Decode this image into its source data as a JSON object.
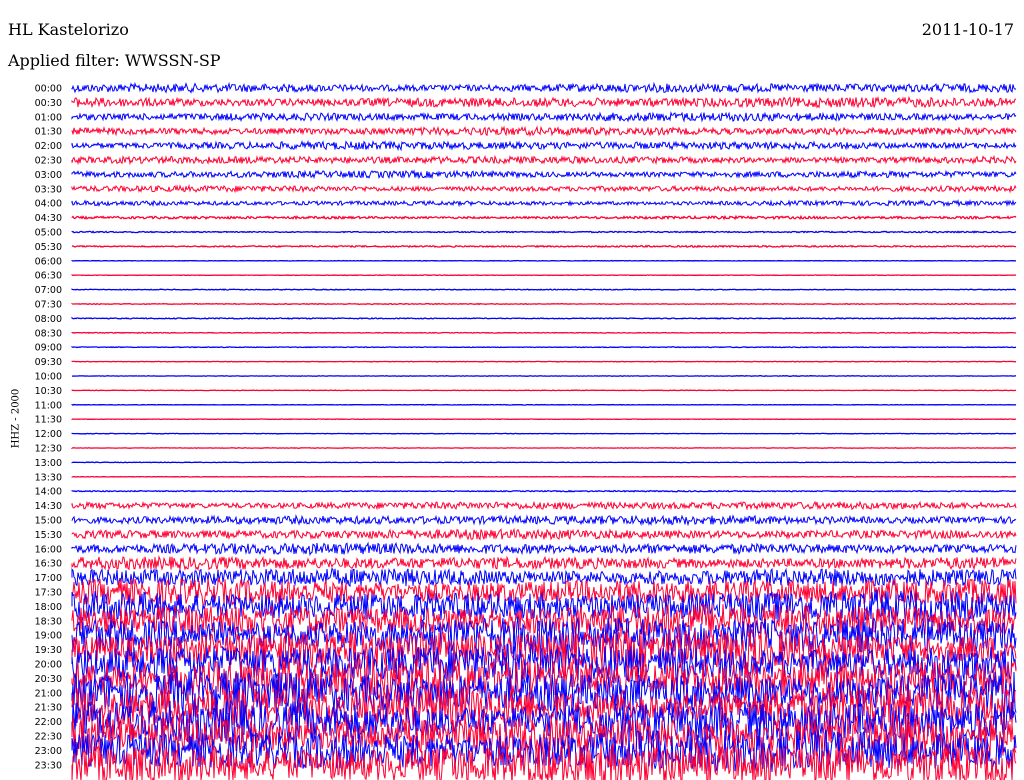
{
  "header": {
    "station": "HL Kastelorizo",
    "date": "2011-10-17",
    "filter": "Applied filter: WWSSN-SP"
  },
  "ylabel": "HHZ - 2000",
  "colors": {
    "a": "#0000ff",
    "b": "#ff0033",
    "text": "#000000",
    "background": "#ffffff"
  },
  "time_labels": [
    "00:00",
    "00:30",
    "01:00",
    "01:30",
    "02:00",
    "02:30",
    "03:00",
    "03:30",
    "04:00",
    "04:30",
    "05:00",
    "05:30",
    "06:00",
    "06:30",
    "07:00",
    "07:30",
    "08:00",
    "08:30",
    "09:00",
    "09:30",
    "10:00",
    "10:30",
    "11:00",
    "11:30",
    "12:00",
    "12:30",
    "13:00",
    "13:30",
    "14:00",
    "14:30",
    "15:00",
    "15:30",
    "16:00",
    "16:30",
    "17:00",
    "17:30",
    "18:00",
    "18:30",
    "19:00",
    "19:30",
    "20:00",
    "20:30",
    "21:00",
    "21:30",
    "22:00",
    "22:30",
    "23:00",
    "23:30"
  ],
  "trace_amplitude": [
    0.34,
    0.38,
    0.32,
    0.3,
    0.3,
    0.28,
    0.26,
    0.22,
    0.18,
    0.1,
    0.05,
    0.06,
    0.02,
    0.02,
    0.03,
    0.03,
    0.04,
    0.03,
    0.03,
    0.02,
    0.02,
    0.02,
    0.02,
    0.02,
    0.02,
    0.02,
    0.02,
    0.02,
    0.04,
    0.28,
    0.34,
    0.36,
    0.42,
    0.48,
    0.7,
    1.0,
    1.2,
    1.3,
    1.4,
    1.5,
    1.5,
    1.6,
    1.6,
    1.6,
    1.6,
    1.6,
    1.6,
    1.6
  ]
}
